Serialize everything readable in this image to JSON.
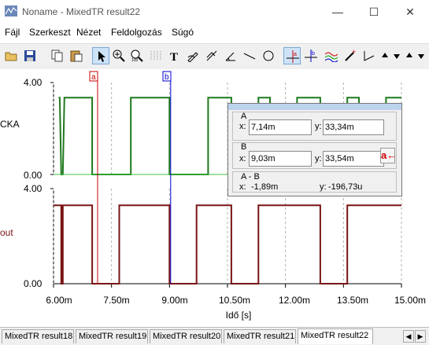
{
  "window": {
    "title": "Noname - MixedTR result22",
    "minimize": "—",
    "maximize": "☐",
    "close": "✕"
  },
  "menu": [
    "Fájl",
    "Szerkeszt",
    "Nézet",
    "Feldolgozás",
    "Súgó"
  ],
  "toolbar": {
    "icons": [
      "open-icon",
      "save-icon",
      "copy-icon",
      "paste-icon",
      "pointer-icon",
      "zoom-in-icon",
      "zoom-fit-icon",
      "grid-icon",
      "text-icon",
      "pen-icon",
      "curve-icon",
      "angle-icon",
      "line-icon",
      "circle-icon",
      "cursor-a-icon",
      "cursor-b-icon",
      "waves-icon",
      "marker-icon",
      "slope-icon",
      "up-icon",
      "down-icon"
    ]
  },
  "plot": {
    "upper": {
      "signal": "CKA",
      "ymax_label": "4.00",
      "ymin_label": "0.00",
      "color": "#1e7a1e"
    },
    "lower": {
      "signal": "out",
      "ymax_label": "4.00",
      "ymin_label": "0.00",
      "color": "#7a1414"
    },
    "x_ticks": [
      "6.00m",
      "7.50m",
      "9.00m",
      "10.50m",
      "12.00m",
      "13.50m",
      "15.00m"
    ],
    "x_label": "Idő [s]",
    "cursor_a_label": "a",
    "cursor_b_label": "b"
  },
  "chart_data": {
    "type": "line",
    "xlabel": "Idő [s]",
    "xlim": [
      0.006,
      0.015
    ],
    "ylim": [
      0,
      4
    ],
    "series": [
      {
        "name": "CKA",
        "x": [
          0.00613,
          0.00616,
          0.0062,
          0.00624,
          0.00628,
          0.00633,
          0.0068,
          0.007,
          0.007,
          0.0077,
          0.0077,
          0.008,
          0.008,
          0.009,
          0.009,
          0.0097,
          0.0097,
          0.01,
          0.01,
          0.0106,
          0.0106,
          0.0113,
          0.0113,
          0.0116,
          0.0116,
          0.0123,
          0.0123,
          0.0129,
          0.0129,
          0.0136,
          0.0136,
          0.0139,
          0.0139,
          0.0146,
          0.0146,
          0.015
        ],
        "y": [
          3.34,
          3.34,
          0,
          0,
          3.34,
          3.34,
          3.34,
          3.34,
          0,
          0,
          0,
          0,
          3.34,
          3.34,
          0,
          0,
          0,
          0,
          3.34,
          3.34,
          0,
          0,
          3.34,
          3.34,
          0,
          0,
          3.34,
          3.34,
          0,
          0,
          3.34,
          3.34,
          0,
          0,
          3.34,
          3.34
        ]
      },
      {
        "name": "out",
        "x": [
          0.006,
          0.0062,
          0.0062,
          0.00624,
          0.00624,
          0.007,
          0.007,
          0.0077,
          0.0077,
          0.009,
          0.009,
          0.0097,
          0.0097,
          0.0106,
          0.0106,
          0.0113,
          0.0113,
          0.0129,
          0.0129,
          0.0136,
          0.0136,
          0.015
        ],
        "y": [
          3.3,
          3.3,
          0,
          0,
          3.3,
          3.3,
          0,
          0,
          3.3,
          3.3,
          0,
          0,
          3.3,
          3.3,
          0,
          0,
          3.3,
          3.3,
          0,
          0,
          3.3,
          3.3
        ]
      }
    ]
  },
  "cursors": {
    "a": {
      "heading": "A",
      "x_label": "x:",
      "x": "7,14m",
      "y_label": "y:",
      "y": "33,34m"
    },
    "b": {
      "heading": "B",
      "x_label": "x:",
      "x": "9,03m",
      "y_label": "y:",
      "y": "33,54m"
    },
    "diff": {
      "heading": "A - B",
      "x_label": "x:",
      "x": "-1,89m",
      "y_label": "y:",
      "y": "-196,73u"
    },
    "ref_button": "a←"
  },
  "tabs": [
    "MixedTR result18",
    "MixedTR result19",
    "MixedTR result20",
    "MixedTR result21",
    "MixedTR result22"
  ],
  "active_tab": 4
}
